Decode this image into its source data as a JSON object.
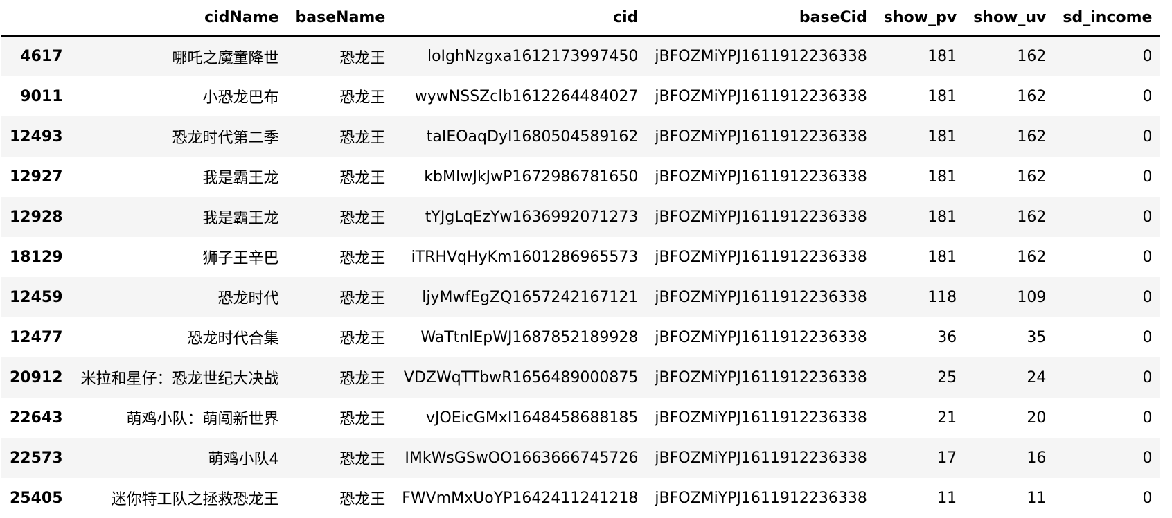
{
  "table": {
    "columns": [
      "",
      "cidName",
      "baseName",
      "cid",
      "baseCid",
      "show_pv",
      "show_uv",
      "sd_income"
    ],
    "rows": [
      {
        "index": "4617",
        "cidName": "哪吒之魔童降世",
        "baseName": "恐龙王",
        "cid": "loIghNzgxa1612173997450",
        "baseCid": "jBFOZMiYPJ1611912236338",
        "show_pv": "181",
        "show_uv": "162",
        "sd_income": "0"
      },
      {
        "index": "9011",
        "cidName": "小恐龙巴布",
        "baseName": "恐龙王",
        "cid": "wywNSSZclb1612264484027",
        "baseCid": "jBFOZMiYPJ1611912236338",
        "show_pv": "181",
        "show_uv": "162",
        "sd_income": "0"
      },
      {
        "index": "12493",
        "cidName": "恐龙时代第二季",
        "baseName": "恐龙王",
        "cid": "taIEOaqDyI1680504589162",
        "baseCid": "jBFOZMiYPJ1611912236338",
        "show_pv": "181",
        "show_uv": "162",
        "sd_income": "0"
      },
      {
        "index": "12927",
        "cidName": "我是霸王龙",
        "baseName": "恐龙王",
        "cid": "kbMIwJkJwP1672986781650",
        "baseCid": "jBFOZMiYPJ1611912236338",
        "show_pv": "181",
        "show_uv": "162",
        "sd_income": "0"
      },
      {
        "index": "12928",
        "cidName": "我是霸王龙",
        "baseName": "恐龙王",
        "cid": "tYJgLqEzYw1636992071273",
        "baseCid": "jBFOZMiYPJ1611912236338",
        "show_pv": "181",
        "show_uv": "162",
        "sd_income": "0"
      },
      {
        "index": "18129",
        "cidName": "狮子王辛巴",
        "baseName": "恐龙王",
        "cid": "iTRHVqHyKm1601286965573",
        "baseCid": "jBFOZMiYPJ1611912236338",
        "show_pv": "181",
        "show_uv": "162",
        "sd_income": "0"
      },
      {
        "index": "12459",
        "cidName": "恐龙时代",
        "baseName": "恐龙王",
        "cid": "ljyMwfEgZQ1657242167121",
        "baseCid": "jBFOZMiYPJ1611912236338",
        "show_pv": "118",
        "show_uv": "109",
        "sd_income": "0"
      },
      {
        "index": "12477",
        "cidName": "恐龙时代合集",
        "baseName": "恐龙王",
        "cid": "WaTtnlEpWJ1687852189928",
        "baseCid": "jBFOZMiYPJ1611912236338",
        "show_pv": "36",
        "show_uv": "35",
        "sd_income": "0"
      },
      {
        "index": "20912",
        "cidName": "米拉和星仔：恐龙世纪大决战",
        "baseName": "恐龙王",
        "cid": "VDZWqTTbwR1656489000875",
        "baseCid": "jBFOZMiYPJ1611912236338",
        "show_pv": "25",
        "show_uv": "24",
        "sd_income": "0"
      },
      {
        "index": "22643",
        "cidName": "萌鸡小队：萌闯新世界",
        "baseName": "恐龙王",
        "cid": "vJOEicGMxI1648458688185",
        "baseCid": "jBFOZMiYPJ1611912236338",
        "show_pv": "21",
        "show_uv": "20",
        "sd_income": "0"
      },
      {
        "index": "22573",
        "cidName": "萌鸡小队4",
        "baseName": "恐龙王",
        "cid": "IMkWsGSwOO1663666745726",
        "baseCid": "jBFOZMiYPJ1611912236338",
        "show_pv": "17",
        "show_uv": "16",
        "sd_income": "0"
      },
      {
        "index": "25405",
        "cidName": "迷你特工队之拯救恐龙王",
        "baseName": "恐龙王",
        "cid": "FWVmMxUoYP1642411241218",
        "baseCid": "jBFOZMiYPJ1611912236338",
        "show_pv": "11",
        "show_uv": "11",
        "sd_income": "0"
      }
    ]
  }
}
